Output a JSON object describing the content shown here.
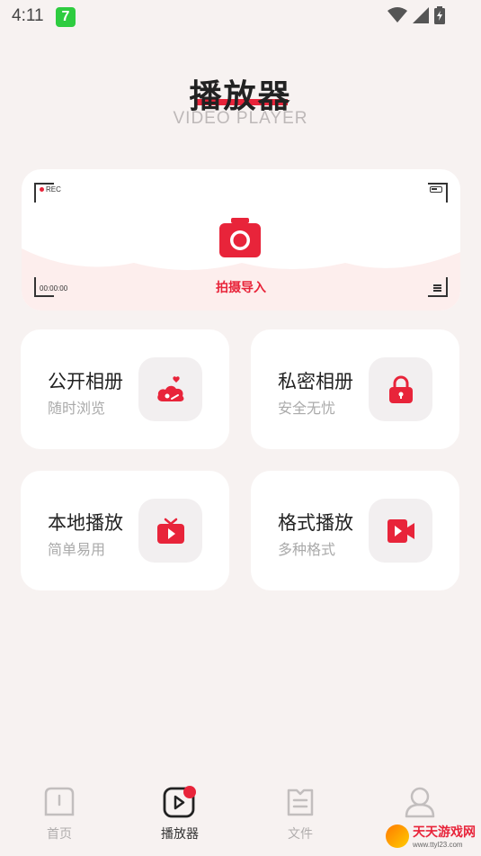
{
  "status_bar": {
    "time": "4:11",
    "app_badge": "7"
  },
  "header": {
    "title": "播放器",
    "subtitle": "VIDEO PLAYER"
  },
  "capture": {
    "rec_label": "REC",
    "timecode": "00:00:00",
    "action_label": "拍摄导入"
  },
  "features": [
    {
      "title": "公开相册",
      "subtitle": "随时浏览",
      "icon": "cloud-heart-icon"
    },
    {
      "title": "私密相册",
      "subtitle": "安全无忧",
      "icon": "lock-icon"
    },
    {
      "title": "本地播放",
      "subtitle": "简单易用",
      "icon": "tv-play-icon"
    },
    {
      "title": "格式播放",
      "subtitle": "多种格式",
      "icon": "video-camera-icon"
    }
  ],
  "bottom_nav": {
    "items": [
      {
        "label": "首页",
        "icon": "home-icon",
        "active": false
      },
      {
        "label": "播放器",
        "icon": "player-icon",
        "active": true
      },
      {
        "label": "文件",
        "icon": "file-icon",
        "active": false
      },
      {
        "label": "",
        "icon": "profile-icon",
        "active": false
      }
    ]
  },
  "watermark": {
    "name": "天天游戏网",
    "url": "www.ttyl23.com"
  },
  "colors": {
    "accent": "#e8243a",
    "background": "#f7f2f1",
    "card": "#ffffff",
    "icon_box": "#f2eff0"
  }
}
